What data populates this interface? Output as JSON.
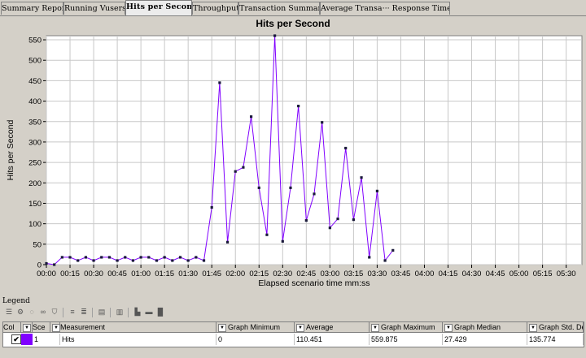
{
  "tabs": [
    {
      "label": "Summary Report",
      "active": false
    },
    {
      "label": "Running Vusers",
      "active": false
    },
    {
      "label": "Hits per Second",
      "active": true
    },
    {
      "label": "Throughput",
      "active": false
    },
    {
      "label": "Transaction Summary",
      "active": false
    },
    {
      "label": "Average Transa··· Response Time",
      "active": false
    }
  ],
  "chart_data": {
    "type": "line",
    "title": "Hits per Second",
    "xlabel": "Elapsed scenario time mm:ss",
    "ylabel": "Hits per Second",
    "ylim": [
      0,
      560
    ],
    "yticks": [
      0,
      50,
      100,
      150,
      200,
      250,
      300,
      350,
      400,
      450,
      500,
      550
    ],
    "xticks": [
      "00:00",
      "00:15",
      "00:30",
      "00:45",
      "01:00",
      "01:15",
      "01:30",
      "01:45",
      "02:00",
      "02:15",
      "02:30",
      "02:45",
      "03:00",
      "03:15",
      "03:30",
      "03:45",
      "04:00",
      "04:15",
      "04:30",
      "04:45",
      "05:00",
      "05:15",
      "05:30"
    ],
    "xlim_seconds": [
      0,
      340
    ],
    "grid": true,
    "series": [
      {
        "name": "Hits",
        "color": "#8000ff",
        "x_seconds": [
          0,
          5,
          10,
          15,
          20,
          25,
          30,
          35,
          40,
          45,
          50,
          55,
          60,
          65,
          70,
          75,
          80,
          85,
          90,
          95,
          100,
          105,
          110,
          115,
          120,
          125,
          130,
          135,
          140,
          145,
          150,
          155,
          160,
          165,
          170,
          175,
          180,
          185,
          190,
          195,
          200,
          205,
          210,
          215,
          220,
          225,
          230,
          235,
          240,
          245,
          250,
          255,
          260,
          265,
          270,
          275,
          280,
          285,
          290,
          295,
          300,
          305,
          310,
          315,
          320,
          325,
          330,
          335,
          340
        ],
        "values": [
          3,
          0,
          18,
          18,
          10,
          18,
          10,
          18,
          18,
          10,
          18,
          10,
          18,
          18,
          10,
          18,
          10,
          18,
          10,
          18,
          10,
          140,
          445,
          55,
          228,
          238,
          362,
          188,
          73,
          560,
          57,
          188,
          388,
          108,
          173,
          348,
          90,
          112,
          285,
          110,
          213,
          18,
          180,
          10,
          35,
          0,
          0,
          0,
          0,
          0,
          0,
          0,
          0,
          0,
          0,
          0,
          0,
          0,
          0,
          0,
          0,
          0,
          0,
          0,
          0,
          0,
          0,
          0,
          0
        ]
      }
    ]
  },
  "legend": {
    "label": "Legend",
    "columns": [
      "Col",
      "Sce",
      "Measurement",
      "Graph Minimum",
      "Average",
      "Graph Maximum",
      "Graph Median",
      "Graph Std. Devia"
    ],
    "rows": [
      {
        "checked": "✔",
        "color": "#8000ff",
        "scale": "1",
        "measurement": "Hits",
        "min": "0",
        "average": "110.451",
        "max": "559.875",
        "median": "27.429",
        "stddev": "135.774"
      }
    ]
  }
}
